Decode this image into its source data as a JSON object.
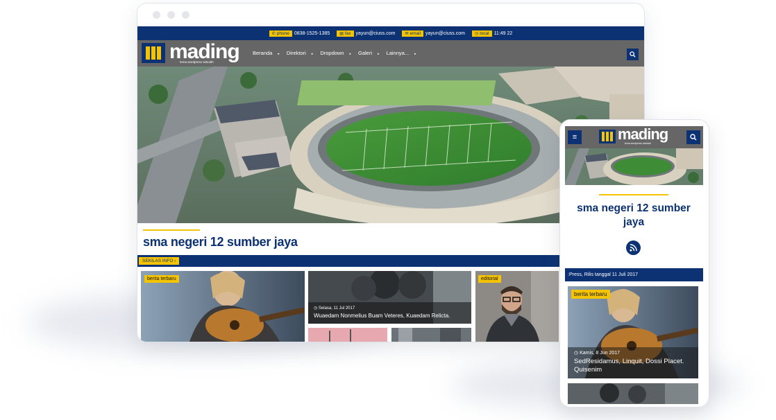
{
  "topbar": {
    "phone_label": "phone",
    "phone_value": "0838-1525-1385",
    "fax_label": "fax",
    "fax_value": "yayun@ciuss.com",
    "email_label": "email",
    "email_value": "yayun@ciuss.com",
    "local_label": "local",
    "local_value": "11:49 22"
  },
  "brand": {
    "name": "mading",
    "tagline": "tema wordpress sekolah"
  },
  "nav": {
    "items": [
      {
        "label": "Beranda"
      },
      {
        "label": "Direktori"
      },
      {
        "label": "Dropdown"
      },
      {
        "label": "Galeri"
      },
      {
        "label": "Lainnya..."
      }
    ]
  },
  "site": {
    "title": "sma negeri 12 sumber jaya"
  },
  "info": {
    "tag": "SEKILAS INFO"
  },
  "cards": {
    "c1_badge": "berita terbaru",
    "c2_date": "Selasa, 11 Jul 2017",
    "c2_title": "Wuaedam Nonmelius Buam Veteres, Kuaedam Relicta.",
    "c3_badge": "editorial"
  },
  "mobile": {
    "title": "sma negeri 12 sumber jaya",
    "ticker": ":Press, Rilis tanggal 11 Juli 2017",
    "card_badge": "berita terbaru",
    "card_date": "Kamis, 8 Jun 2017",
    "card_title": "SedResidamus, Linquit, Dossi Placet. Quisenim"
  },
  "colors": {
    "navy": "#0c3273",
    "yellow": "#f5c400",
    "gray": "#666666"
  }
}
